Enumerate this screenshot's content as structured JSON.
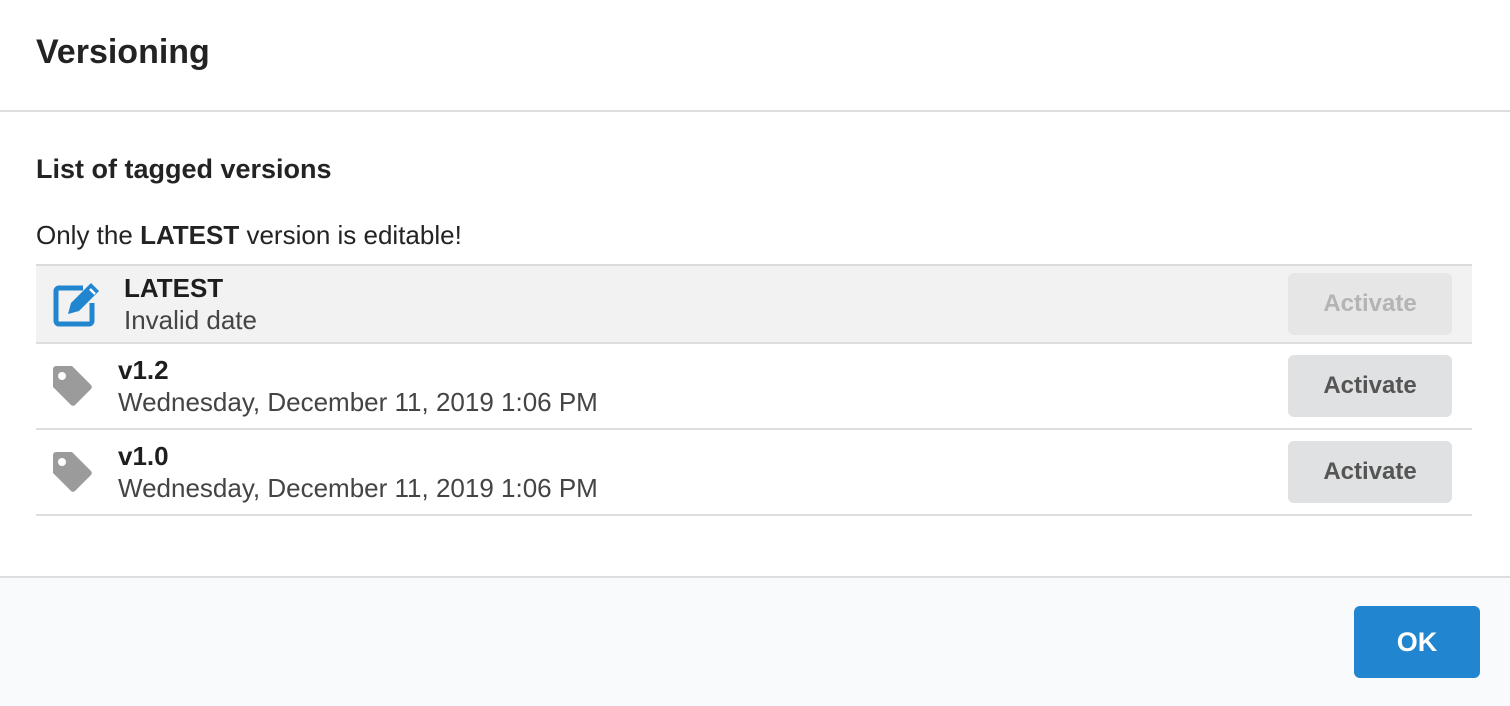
{
  "dialog": {
    "title": "Versioning"
  },
  "content": {
    "section_title": "List of tagged versions",
    "note": {
      "prefix": "Only the ",
      "highlight": "LATEST",
      "suffix": " version is editable!"
    }
  },
  "versions": [
    {
      "name": "LATEST",
      "date": "Invalid date",
      "icon": "edit-icon",
      "button_label": "Activate",
      "button_disabled": true
    },
    {
      "name": "v1.2",
      "date": "Wednesday, December 11, 2019 1:06 PM",
      "icon": "tag-icon",
      "button_label": "Activate",
      "button_disabled": false
    },
    {
      "name": "v1.0",
      "date": "Wednesday, December 11, 2019 1:06 PM",
      "icon": "tag-icon",
      "button_label": "Activate",
      "button_disabled": false
    }
  ],
  "actions": {
    "ok_label": "OK"
  },
  "colors": {
    "primary": "#2185d0",
    "edit_icon": "#2185d0",
    "tag_icon": "#9b9b9b",
    "active_row_bg": "#f2f2f2"
  }
}
